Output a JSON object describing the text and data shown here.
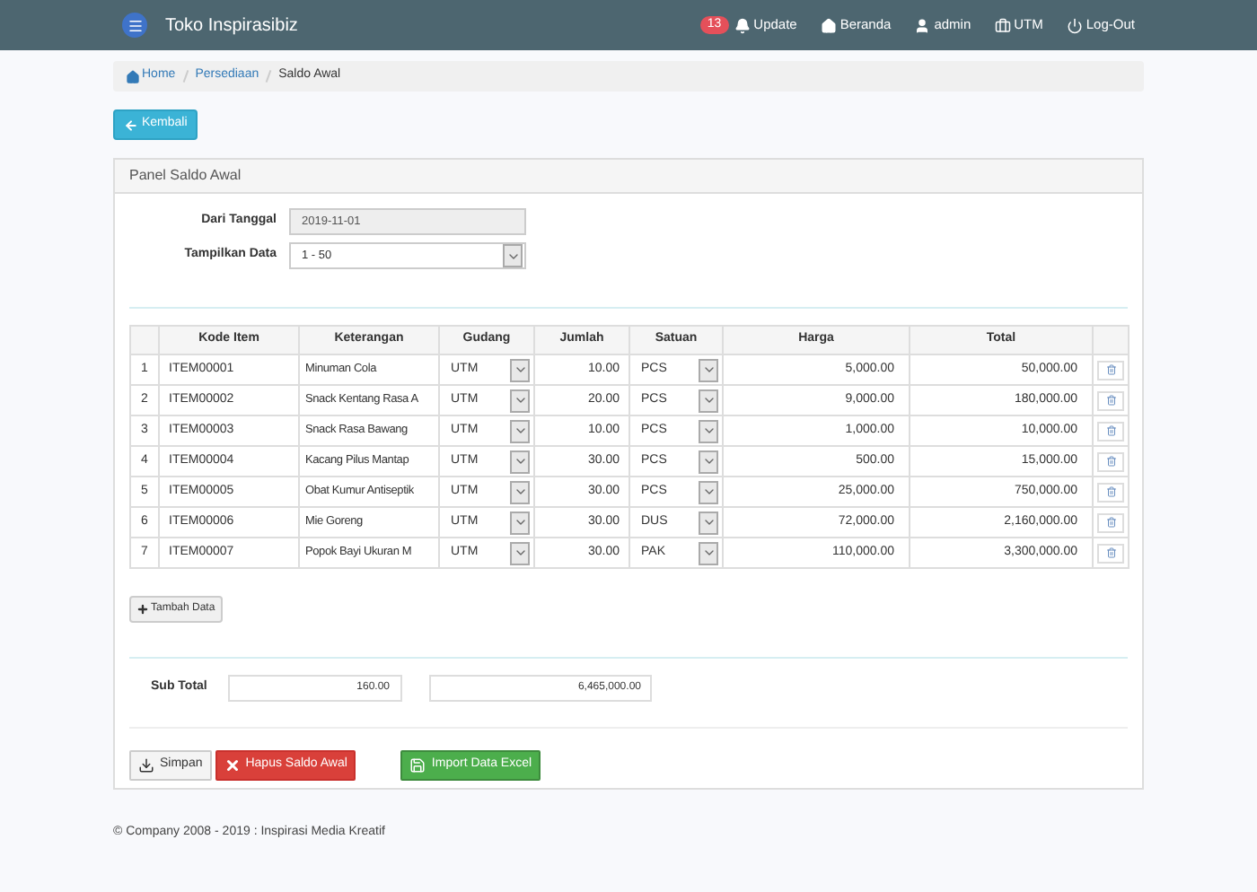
{
  "navbar": {
    "title": "Toko Inspirasibiz",
    "badge": "13",
    "links": [
      {
        "kind": "bell",
        "label": "Update"
      },
      {
        "kind": "home",
        "label": "Beranda"
      },
      {
        "kind": "user",
        "label": "admin"
      },
      {
        "kind": "briefcase",
        "label": "UTM"
      },
      {
        "kind": "power",
        "label": "Log-Out"
      }
    ]
  },
  "breadcrumb": [
    {
      "label": "Home",
      "current": false
    },
    {
      "label": "Persediaan",
      "current": false
    },
    {
      "label": "Saldo Awal",
      "current": true
    }
  ],
  "back_button": "Kembali",
  "panel": {
    "title": "Panel Saldo Awal",
    "form": [
      {
        "kind": "input",
        "label": "Dari Tanggal",
        "value": "2019-11-01"
      },
      {
        "kind": "select",
        "label": "Tampilkan Data",
        "value": "1 - 50"
      }
    ],
    "table": {
      "columns": [
        "Kode Item",
        "Keterangan",
        "Gudang",
        "Jumlah",
        "Satuan",
        "Harga",
        "Total"
      ],
      "rows": [
        {
          "no": "1",
          "kode": "ITEM00001",
          "keterangan": "Minuman Cola",
          "gudang": "UTM",
          "jumlah": "10.00",
          "satuan": "PCS",
          "harga": "5,000.00",
          "total": "50,000.00"
        },
        {
          "no": "2",
          "kode": "ITEM00002",
          "keterangan": "Snack Kentang Rasa A",
          "gudang": "UTM",
          "jumlah": "20.00",
          "satuan": "PCS",
          "harga": "9,000.00",
          "total": "180,000.00"
        },
        {
          "no": "3",
          "kode": "ITEM00003",
          "keterangan": "Snack Rasa Bawang",
          "gudang": "UTM",
          "jumlah": "10.00",
          "satuan": "PCS",
          "harga": "1,000.00",
          "total": "10,000.00"
        },
        {
          "no": "4",
          "kode": "ITEM00004",
          "keterangan": "Kacang Pilus Mantap",
          "gudang": "UTM",
          "jumlah": "30.00",
          "satuan": "PCS",
          "harga": "500.00",
          "total": "15,000.00"
        },
        {
          "no": "5",
          "kode": "ITEM00005",
          "keterangan": "Obat Kumur Antiseptik",
          "gudang": "UTM",
          "jumlah": "30.00",
          "satuan": "PCS",
          "harga": "25,000.00",
          "total": "750,000.00"
        },
        {
          "no": "6",
          "kode": "ITEM00006",
          "keterangan": "Mie Goreng",
          "gudang": "UTM",
          "jumlah": "30.00",
          "satuan": "DUS",
          "harga": "72,000.00",
          "total": "2,160,000.00"
        },
        {
          "no": "7",
          "kode": "ITEM00007",
          "keterangan": "Popok Bayi Ukuran M",
          "gudang": "UTM",
          "jumlah": "30.00",
          "satuan": "PAK",
          "harga": "110,000.00",
          "total": "3,300,000.00"
        }
      ]
    },
    "add_button": "Tambah Data",
    "subtotal": {
      "label": "Sub Total",
      "quantity": "160.00",
      "amount": "6,465,000.00"
    },
    "actions": [
      {
        "kind": "save",
        "label": "Simpan"
      },
      {
        "kind": "delete",
        "label": "Hapus Saldo Awal"
      },
      {
        "kind": "import",
        "label": "Import Data Excel"
      }
    ]
  },
  "footer": "© Company 2008 - 2019 : Inspirasi Media Kreatif"
}
